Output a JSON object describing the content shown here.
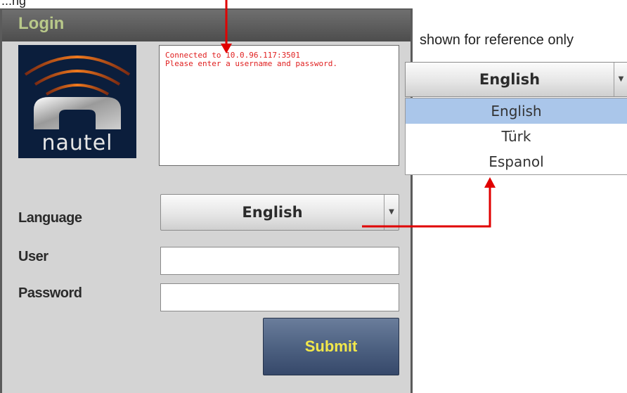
{
  "annotation": {
    "top_partial_text": "...ng",
    "reference_note": "shown for reference only",
    "arrow_color": "#e00000"
  },
  "panel": {
    "title": "Login",
    "logo": {
      "text": "nautel"
    },
    "message_box": {
      "lines": [
        "Connected to 10.0.96.117:3501",
        "Please enter a username and password."
      ]
    },
    "language": {
      "label": "Language",
      "selected": "English"
    },
    "user": {
      "label": "User",
      "value": ""
    },
    "password": {
      "label": "Password",
      "value": ""
    },
    "submit_label": "Submit"
  },
  "reference_dropdown": {
    "selected": "English",
    "options": [
      "English",
      "Türk",
      "Espanol"
    ],
    "highlighted": "English"
  },
  "colors": {
    "title_color": "#b9c98a",
    "message_color": "#e02020",
    "submit_text": "#f2e84a",
    "submit_bg": "#4e6282",
    "highlight": "#aac6ea"
  }
}
